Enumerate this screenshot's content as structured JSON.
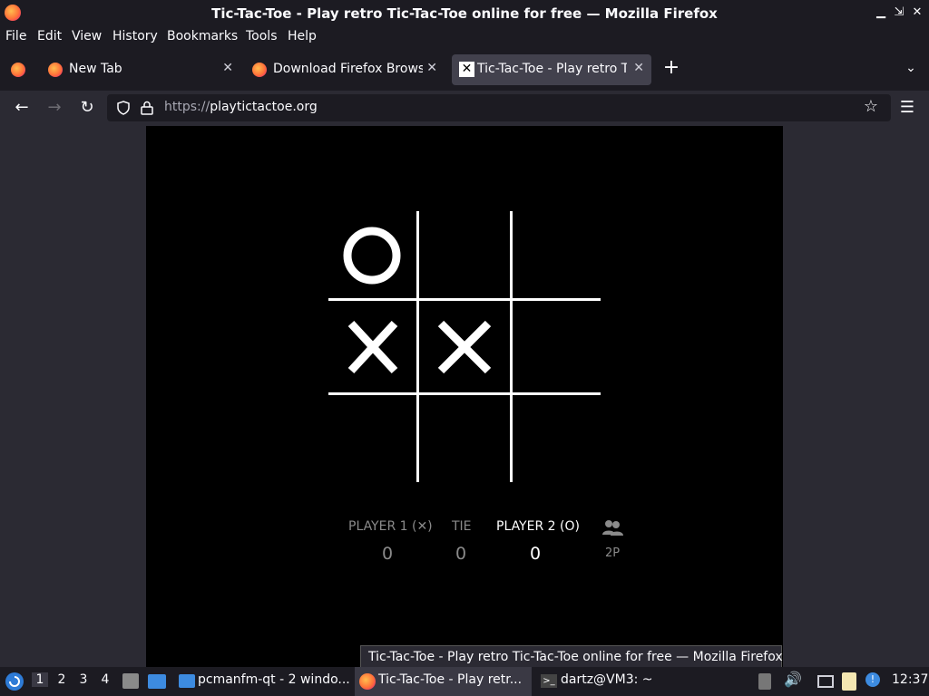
{
  "window": {
    "title": "Tic-Tac-Toe - Play retro Tic-Tac-Toe online for free — Mozilla Firefox"
  },
  "menu": [
    "File",
    "Edit",
    "View",
    "History",
    "Bookmarks",
    "Tools",
    "Help"
  ],
  "tabs": [
    {
      "label": "New Tab",
      "active": false
    },
    {
      "label": "Download Firefox Browse",
      "active": false
    },
    {
      "label": "Tic-Tac-Toe - Play retro Tic",
      "active": true
    }
  ],
  "navbar": {
    "url_scheme": "https://",
    "url_host": "playtictactoe.org"
  },
  "game": {
    "board": [
      "O",
      "",
      "",
      "X",
      "X",
      "",
      "",
      "",
      ""
    ],
    "player1_label": "PLAYER 1 (✕)",
    "player1_score": "0",
    "tie_label": "TIE",
    "tie_score": "0",
    "player2_label": "PLAYER 2 (O)",
    "player2_score": "0",
    "mode_label": "2P"
  },
  "tooltip": "Tic-Tac-Toe - Play retro Tic-Tac-Toe online for free — Mozilla Firefox",
  "taskbar": {
    "workspaces": [
      "1",
      "2",
      "3",
      "4"
    ],
    "task1": "pcmanfm-qt - 2 windo...",
    "task2": "Tic-Tac-Toe - Play retr...",
    "task3": "dartz@VM3: ~",
    "clock": "12:37"
  },
  "colors": {
    "accent": "#ff7139",
    "background": "#000000"
  }
}
